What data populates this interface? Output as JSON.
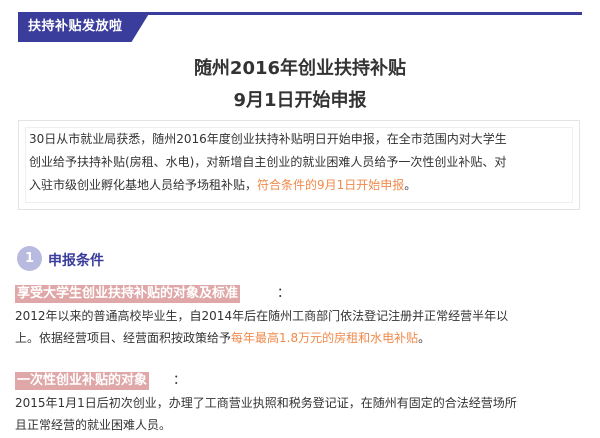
{
  "header": {
    "tag": "扶持补贴发放啦"
  },
  "title": {
    "line1": "随州2016年创业扶持补贴",
    "line2": "9月1日开始申报"
  },
  "summary": {
    "line1": "30日从市就业局获悉，随州2016年度创业扶持补贴明日开始申报，在全市范围内对大学生",
    "line2": "创业给予扶持补贴(房租、水电)，对新增自主创业的就业困难人员给予一次性创业补贴、对",
    "line3_plain": "入驻市级创业孵化基地人员给予场租补贴，",
    "line3_highlight": "符合条件的9月1日开始申报",
    "line3_end": "。"
  },
  "section": {
    "number": "1",
    "title": "申报条件"
  },
  "block1": {
    "heading": "享受大学生创业扶持补贴的对象及标准",
    "colon": "：",
    "line1": "2012年以来的普通高校毕业生，自2014年后在随州工商部门依法登记注册并正常经营半年以",
    "line2_plain": "上。依据经营项目、经营面积按政策给予",
    "line2_highlight": "每年最高1.8万元的房租和水电补贴",
    "line2_end": "。"
  },
  "block2": {
    "heading": "一次性创业补贴的对象",
    "colon": "：",
    "line1": "2015年1月1日后初次创业，办理了工商营业执照和税务登记证，在随州有固定的合法经营场所",
    "line2": "且正常经营的就业困难人员。"
  },
  "colors": {
    "brand": "#3b3d9c",
    "highlight_text": "#f08a4b",
    "heading_background": "#dfa7a7",
    "badge": "#b9badf"
  }
}
